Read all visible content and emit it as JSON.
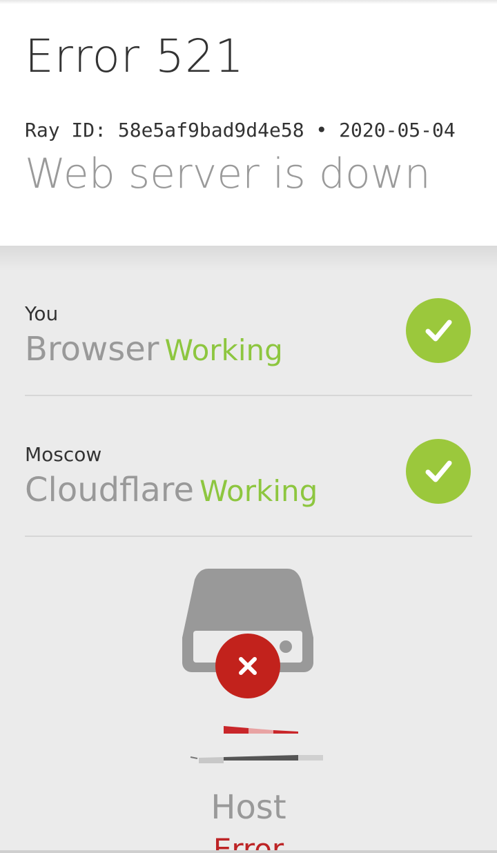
{
  "error": {
    "title": "Error 521",
    "ray_line": "Ray ID: 58e5af9bad9d4e58 • 2020-05-04",
    "subtitle": "Web server is down"
  },
  "nodes": [
    {
      "location": "You",
      "name": "Browser",
      "status": "Working",
      "status_color": "#8dc63f",
      "icon": "check-icon"
    },
    {
      "location": "Moscow",
      "name": "Cloudflare",
      "status": "Working",
      "status_color": "#8dc63f",
      "icon": "check-icon"
    }
  ],
  "host": {
    "name": "Host",
    "status": "Error",
    "status_color": "#bd2426",
    "icon": "server-icon",
    "badge_icon": "x-icon"
  }
}
